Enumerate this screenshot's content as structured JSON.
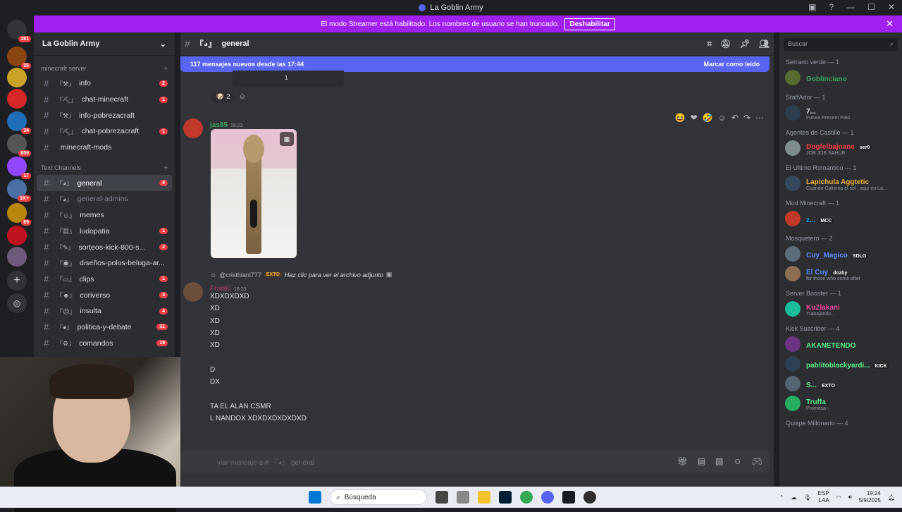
{
  "window": {
    "title": "La Goblin Army"
  },
  "banner": {
    "text": "El modo Streamer está habilitado. Los nombres de usuario se han truncado.",
    "button": "Deshabilitar"
  },
  "server": {
    "name": "La Goblin Army"
  },
  "server_badges": [
    "381",
    "35",
    "34",
    "659",
    "17",
    "1K+",
    "89"
  ],
  "categories": [
    {
      "name": "minecraft server",
      "channels": [
        {
          "emoji": "『⚒』",
          "name": "info",
          "count": "2"
        },
        {
          "emoji": "『⛏』",
          "name": "chat-minecraft",
          "count": "1"
        },
        {
          "emoji": "『⚒』",
          "name": "info-pobrezacraft",
          "count": ""
        },
        {
          "emoji": "『⛏』",
          "name": "chat-pobrezacraft",
          "count": "1"
        },
        {
          "emoji": "",
          "name": "minecraft-mods",
          "count": ""
        }
      ]
    },
    {
      "name": "Text Channels",
      "channels": [
        {
          "emoji": "『◕』",
          "name": "general",
          "count": "4",
          "active": true
        },
        {
          "emoji": "『◕』",
          "name": "general-admins",
          "count": "",
          "muted": true
        },
        {
          "emoji": "『☺』",
          "name": "memes",
          "count": ""
        },
        {
          "emoji": "『▦』",
          "name": "ludopatia",
          "count": "1"
        },
        {
          "emoji": "『✎』",
          "name": "sorteos-kick-800-s...",
          "count": "2"
        },
        {
          "emoji": "『◉』",
          "name": "diseños-polos-beluga-ar...",
          "count": ""
        },
        {
          "emoji": "『▭』",
          "name": "clips",
          "count": "1"
        },
        {
          "emoji": "『☻』",
          "name": "coriverso",
          "count": "3"
        },
        {
          "emoji": "『☹』",
          "name": "insulta",
          "count": "4"
        },
        {
          "emoji": "『●』",
          "name": "politica-y-debate",
          "count": "31"
        },
        {
          "emoji": "『⚙』",
          "name": "comandos",
          "count": "19"
        }
      ]
    }
  ],
  "chat": {
    "channel_emoji": "『◕』",
    "channel_name": "general",
    "new_messages": "117 mensajes nuevos desde las 17:44",
    "mark_read": "Marcar como leído",
    "reaction_count": "2",
    "prev_react": "1",
    "msg1": {
      "user": "jas85",
      "time": "18:23",
      "user_color": "#3ba55d"
    },
    "reply": {
      "user": "@cristhiani777",
      "tag": "EXTO",
      "text": "Haz clic para ver el archivo adjunto"
    },
    "msg2": {
      "user": "Franki",
      "time": "18:23",
      "user_color": "#8e3a5e",
      "lines": [
        "XDXDXDXD",
        "XD",
        "XD",
        "XD",
        "XD",
        "",
        "D",
        "DX",
        "",
        "TA EL ALAN CSMR",
        "L NANDOX XDXDXDXDXDXD"
      ]
    },
    "input_placeholder": "viar mensaje a # 『◕』 general"
  },
  "member_search": "Buscar",
  "members": [
    {
      "group": "Serrano verde — 1",
      "items": [
        {
          "name": "Goblinciano",
          "color": "#3ba55d",
          "status": "",
          "tag": ""
        }
      ]
    },
    {
      "group": "StaffAdor — 1",
      "items": [
        {
          "name": "7...",
          "color": "#f2f3f5",
          "status": "Future Present Past",
          "tag": ""
        }
      ]
    },
    {
      "group": "Agentes de Castillo — 1",
      "items": [
        {
          "name": "Dogfelbajnane",
          "color": "#f23f43",
          "status": "JOB JOB SAHUR",
          "tag": "ser0"
        }
      ]
    },
    {
      "group": "El Ultimo Romantico — 1",
      "items": [
        {
          "name": "Lapichula Aggtetic",
          "color": "#f0b232",
          "status": "Cuando Calienta el sol , aqui en La...",
          "tag": ""
        }
      ]
    },
    {
      "group": "Mod Minecraft — 1",
      "items": [
        {
          "name": "z...",
          "color": "#00a8fc",
          "status": "",
          "tag": "MCC"
        }
      ]
    },
    {
      "group": "Mosquetero — 2",
      "items": [
        {
          "name": "Cuy_Magico",
          "color": "#5b8cff",
          "status": "",
          "tag": "SDLG"
        },
        {
          "name": "El Cuy",
          "color": "#5b8cff",
          "status": "for those who come after",
          "tag": "dozby"
        }
      ]
    },
    {
      "group": "Server Booster — 1",
      "items": [
        {
          "name": "KuZlakani",
          "color": "#eb459e",
          "status": "Trabajando ...",
          "tag": ""
        }
      ]
    },
    {
      "group": "Kick Suscriber — 4",
      "items": [
        {
          "name": "AKANETENDO",
          "color": "#57f287",
          "status": "",
          "tag": ""
        },
        {
          "name": "pablitoblackyardi...",
          "color": "#57f287",
          "status": "",
          "tag": "KICK"
        },
        {
          "name": "S...",
          "color": "#57f287",
          "status": "",
          "tag": "EXTO"
        },
        {
          "name": "Truffa",
          "color": "#57f287",
          "status": "Promesa~",
          "tag": ""
        }
      ]
    },
    {
      "group": "Quispe Millonario — 4",
      "items": []
    }
  ],
  "taskbar": {
    "search": "Búsqueda",
    "lang": "ESP",
    "lang2": "LAA",
    "time": "19:24",
    "date": "5/9/2025"
  }
}
